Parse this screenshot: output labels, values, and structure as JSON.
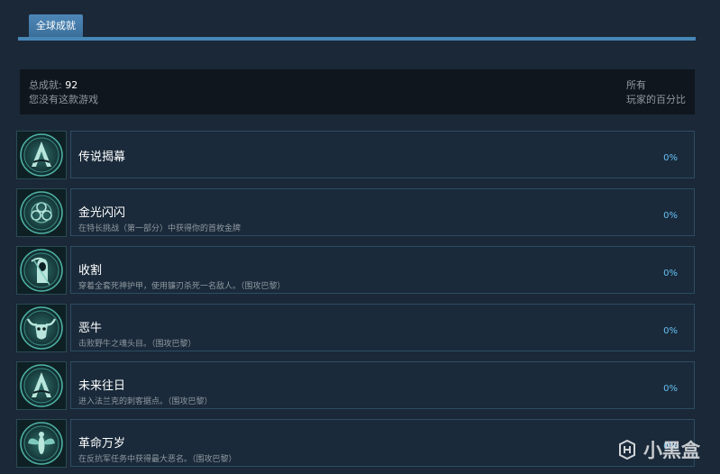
{
  "tab": {
    "label": "全球成就"
  },
  "summary": {
    "total_label": "总成就: ",
    "total_value": "92",
    "ownership": "您没有这款游戏",
    "right_line1": "所有",
    "right_line2": "玩家的百分比"
  },
  "achievements": [
    {
      "title": "传说揭幕",
      "desc": "",
      "percent": "0%",
      "icon": "hidden-blade-icon"
    },
    {
      "title": "金光闪闪",
      "desc": "在特长挑战（第一部分）中获得你的首枚金牌",
      "percent": "0%",
      "icon": "knot-medallion-icon"
    },
    {
      "title": "收割",
      "desc": "穿着全套死神护甲，使用镰刃杀死一名敌人。（围攻巴黎）",
      "percent": "0%",
      "icon": "reaper-icon"
    },
    {
      "title": "恶牛",
      "desc": "击败野牛之魂头目。（围攻巴黎）",
      "percent": "0%",
      "icon": "bull-skull-icon"
    },
    {
      "title": "未来往日",
      "desc": "进入法兰克的刺客据点。（围攻巴黎）",
      "percent": "0%",
      "icon": "hidden-blade-icon"
    },
    {
      "title": "革命万岁",
      "desc": "在反抗军任务中获得最大恶名。（围攻巴黎）",
      "percent": "0%",
      "icon": "wasp-icon"
    }
  ],
  "watermark": {
    "text": "小黑盒"
  },
  "colors": {
    "accent": "#66c0f4",
    "tab": "#4787b6",
    "background": "#1b2838"
  }
}
